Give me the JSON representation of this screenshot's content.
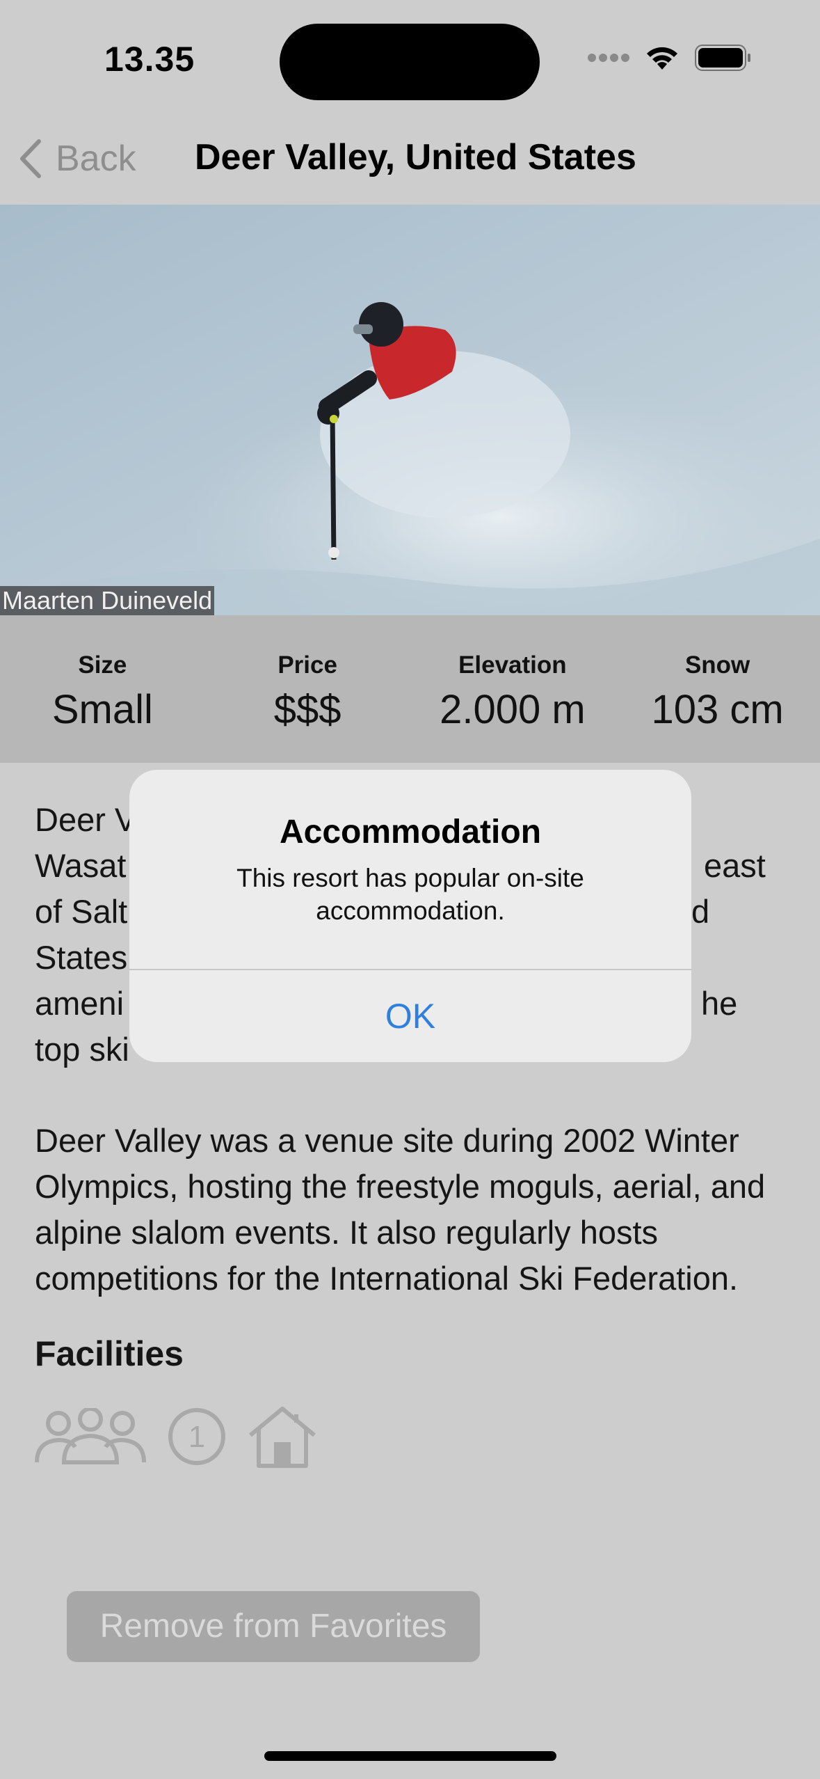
{
  "status_bar": {
    "time": "13.35"
  },
  "nav": {
    "back_label": "Back",
    "title": "Deer Valley, United States"
  },
  "hero": {
    "photo_credit": "Maarten Duineveld"
  },
  "stats": [
    {
      "label": "Size",
      "value": "Small"
    },
    {
      "label": "Price",
      "value": "$$$"
    },
    {
      "label": "Elevation",
      "value": "2.000 m"
    },
    {
      "label": "Snow",
      "value": "103 cm"
    }
  ],
  "description": {
    "paragraph1_lines": [
      "Deer V",
      "Wasat",
      "east",
      "of Salt",
      "d",
      "States",
      "ameni",
      "he",
      "top ski"
    ],
    "paragraph2": "Deer Valley was a venue site during 2002 Winter Olympics, hosting the freestyle moguls, aerial, and alpine slalom events. It also regularly hosts competitions for the International Ski Federation."
  },
  "facilities": {
    "title": "Facilities",
    "icons": [
      "people-group-icon",
      "number-one-circle-icon",
      "house-icon"
    ]
  },
  "favorites_button": "Remove from Favorites",
  "alert": {
    "title": "Accommodation",
    "message": "This resort has popular on-site accommodation.",
    "ok_label": "OK"
  },
  "colors": {
    "dim_background": "#cdcdcd",
    "stats_band": "#b7b7b7",
    "alert_background": "#ececec",
    "accent": "#2e7fe0"
  }
}
